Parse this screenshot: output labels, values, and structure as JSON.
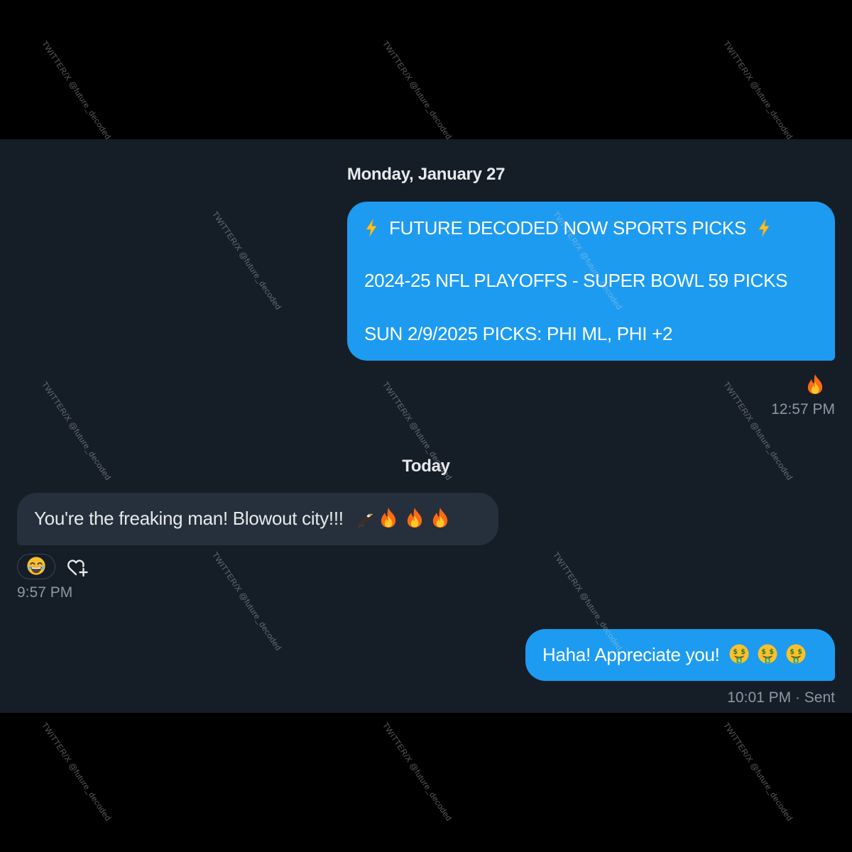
{
  "watermark_text": "TWITTER/X @future_decoded",
  "conversation": {
    "date_separator_1": "Monday, January 27",
    "date_separator_2": "Today",
    "messages": [
      {
        "direction": "outgoing",
        "lines": [
          "FUTURE DECODED NOW SPORTS PICKS",
          "2024-25 NFL PLAYOFFS - SUPER BOWL 59 PICKS",
          "SUN 2/9/2025 PICKS: PHI ML, PHI +2"
        ],
        "icons": [
          "lightning-bolt-icon",
          "lightning-bolt-icon"
        ],
        "reaction": "fire-emoji",
        "time": "12:57 PM"
      },
      {
        "direction": "incoming",
        "text": "You're the freaking man! Blowout city!!!",
        "emojis": [
          "eagle-emoji",
          "fire-emoji",
          "fire-emoji",
          "fire-emoji"
        ],
        "reaction": "laughing-emoji",
        "time": "9:57 PM"
      },
      {
        "direction": "outgoing",
        "text": "Haha! Appreciate you!",
        "emojis": [
          "money-mouth-emoji",
          "money-mouth-emoji",
          "money-mouth-emoji"
        ],
        "time": "10:01 PM · Sent"
      }
    ]
  },
  "colors": {
    "background": "#000000",
    "chat_background": "#151d27",
    "outgoing_bubble": "#1d9bf0",
    "incoming_bubble": "#25303c",
    "secondary_text": "#8b98a5"
  }
}
